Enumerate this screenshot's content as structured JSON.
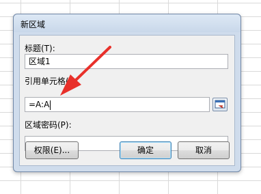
{
  "dialog": {
    "title": "新区域",
    "title_label": "标题(T):",
    "title_value": "区域1",
    "ref_label": "引用单元格(",
    "ref_label_tail": "R",
    "ref_value": "=A:A",
    "password_label": "区域密码(P):",
    "password_value": "",
    "buttons": {
      "permissions": "权限(E)...",
      "ok": "确定",
      "cancel": "取消"
    }
  },
  "annotation": {
    "arrow_color": "#e8302a"
  },
  "icons": {
    "collapse": "range-collapse-icon",
    "arrow": "red-arrow-annotation"
  }
}
